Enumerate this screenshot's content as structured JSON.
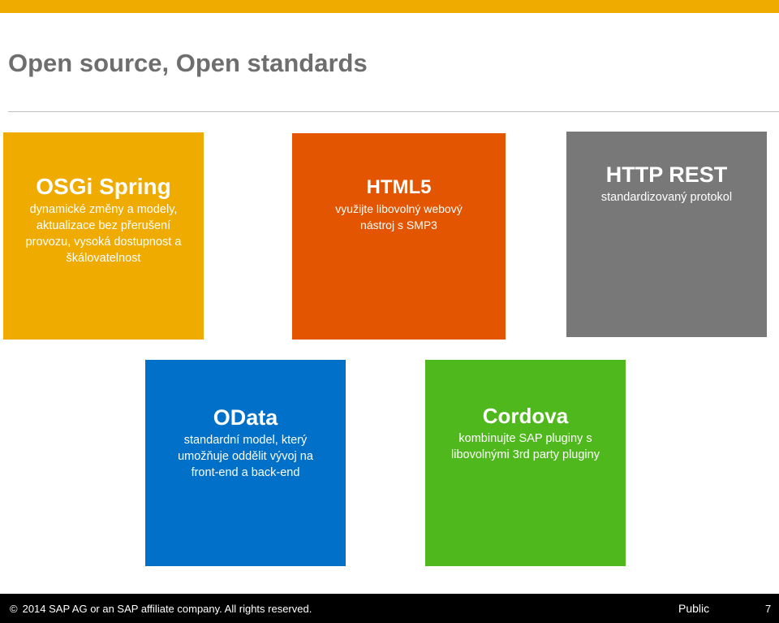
{
  "colors": {
    "top_bar": "#f0ab00",
    "osgi": "#f0ab00",
    "html5": "#e35500",
    "http": "#787878",
    "odata": "#0070c8",
    "cordova": "#4fb81c",
    "footer": "#000000"
  },
  "slide": {
    "title": "Open source, Open standards"
  },
  "tiles": [
    {
      "id": "osgi",
      "title": "OSGi Spring",
      "description": "dynamické změny a modely,\naktualizace bez přerušení\nprovozu, vysoká dostupnost a\nškálovatelnost"
    },
    {
      "id": "html5",
      "title": "HTML5",
      "description": "využijte libovolný webový\nnástroj s SMP3"
    },
    {
      "id": "http",
      "title": "HTTP REST",
      "description": "standardizovaný protokol"
    },
    {
      "id": "odata",
      "title": "OData",
      "description": "standardní model, který\numožňuje oddělit vývoj na\nfront-end a back-end"
    },
    {
      "id": "cordova",
      "title": "Cordova",
      "description": "kombinujte SAP pluginy s\nlibovolnými 3rd party pluginy"
    }
  ],
  "footer": {
    "copyright_symbol": "©",
    "copyright_text": "2014 SAP AG or an SAP affiliate company. All rights reserved.",
    "classification": "Public",
    "page_number": "7"
  }
}
